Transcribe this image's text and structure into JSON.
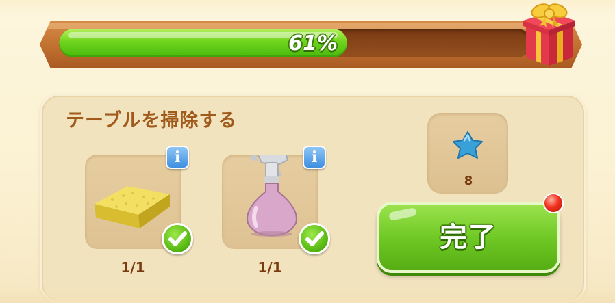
{
  "progress": {
    "percent": 61,
    "label": "61%",
    "reward_icon": "gift-box-icon"
  },
  "task": {
    "title": "テーブルを掃除する",
    "items": [
      {
        "icon": "sponge-icon",
        "quantity": "1/1",
        "info_label": "i",
        "completed": true
      },
      {
        "icon": "spray-bottle-icon",
        "quantity": "1/1",
        "info_label": "i",
        "completed": true
      }
    ],
    "reward": {
      "icon": "blue-star-icon",
      "count": "8"
    },
    "complete_button": {
      "label": "完了",
      "has_notification": true
    }
  },
  "colors": {
    "progress_fill": "#6fd41d",
    "progress_frame": "#c0702f",
    "title_text": "#a05a1c",
    "button_green": "#70c925",
    "info_blue": "#3e8fe0",
    "notification_red": "#f0321e",
    "reward_star": "#3aa0d8"
  }
}
